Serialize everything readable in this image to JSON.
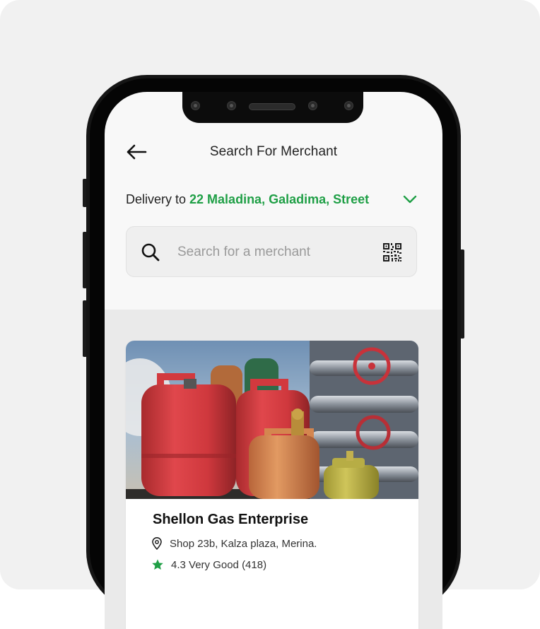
{
  "header": {
    "title": "Search For Merchant",
    "back_icon": "arrow-left-icon"
  },
  "delivery": {
    "prefix": "Delivery to ",
    "address": "22 Maladina, Galadima, Street",
    "chevron_icon": "chevron-down-icon"
  },
  "search": {
    "placeholder": "Search for a merchant",
    "value": "",
    "search_icon": "search-icon",
    "scan_icon": "qr-code-icon"
  },
  "merchants": [
    {
      "name": "Shellon Gas Enterprise",
      "address": "Shop 23b, Kalza plaza, Merina.",
      "rating": "4.3 Very Good (418)",
      "image_icon": "gas-cylinders-photo"
    }
  ],
  "colors": {
    "accent": "#1f9f46",
    "screen_bg": "#f8f8f8",
    "list_bg": "#eaeaea",
    "text": "#222222"
  }
}
